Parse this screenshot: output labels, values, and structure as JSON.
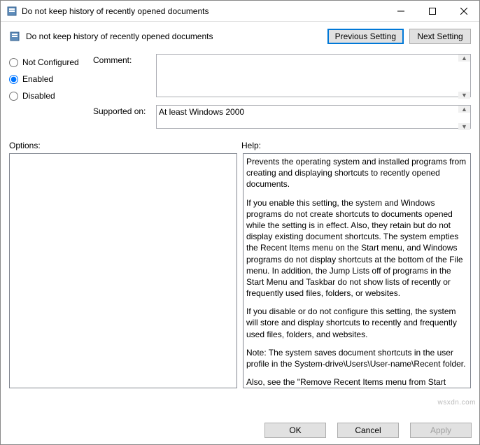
{
  "window": {
    "title": "Do not keep history of recently opened documents"
  },
  "header": {
    "title": "Do not keep history of recently opened documents",
    "prev_btn": "Previous Setting",
    "next_btn": "Next Setting"
  },
  "radio": {
    "not_configured": "Not Configured",
    "enabled": "Enabled",
    "disabled": "Disabled",
    "selected": "enabled"
  },
  "fields": {
    "comment_label": "Comment:",
    "comment_value": "",
    "supported_label": "Supported on:",
    "supported_value": "At least Windows 2000"
  },
  "labels": {
    "options": "Options:",
    "help": "Help:"
  },
  "help": {
    "p1": "Prevents the operating system and installed programs from creating and displaying shortcuts to recently opened documents.",
    "p2": "If you enable this setting, the system and Windows programs do not create shortcuts to documents opened while the setting is in effect. Also, they retain but do not display existing document shortcuts. The system empties the Recent Items menu on the Start menu, and Windows programs do not display shortcuts at the bottom of the File menu. In addition, the Jump Lists off of programs in the Start Menu and Taskbar do not show lists of recently or frequently used files, folders, or websites.",
    "p3": "If you disable or do not configure this setting, the system will store and display shortcuts to recently and frequently used files, folders, and websites.",
    "p4": "Note: The system saves document shortcuts in the user profile in the System-drive\\Users\\User-name\\Recent folder.",
    "p5": "Also, see the \"Remove Recent Items menu from Start Menu\" and \"Clear history of recently opened documents on exit\" policies in"
  },
  "footer": {
    "ok": "OK",
    "cancel": "Cancel",
    "apply": "Apply"
  },
  "watermark": "wsxdn.com"
}
